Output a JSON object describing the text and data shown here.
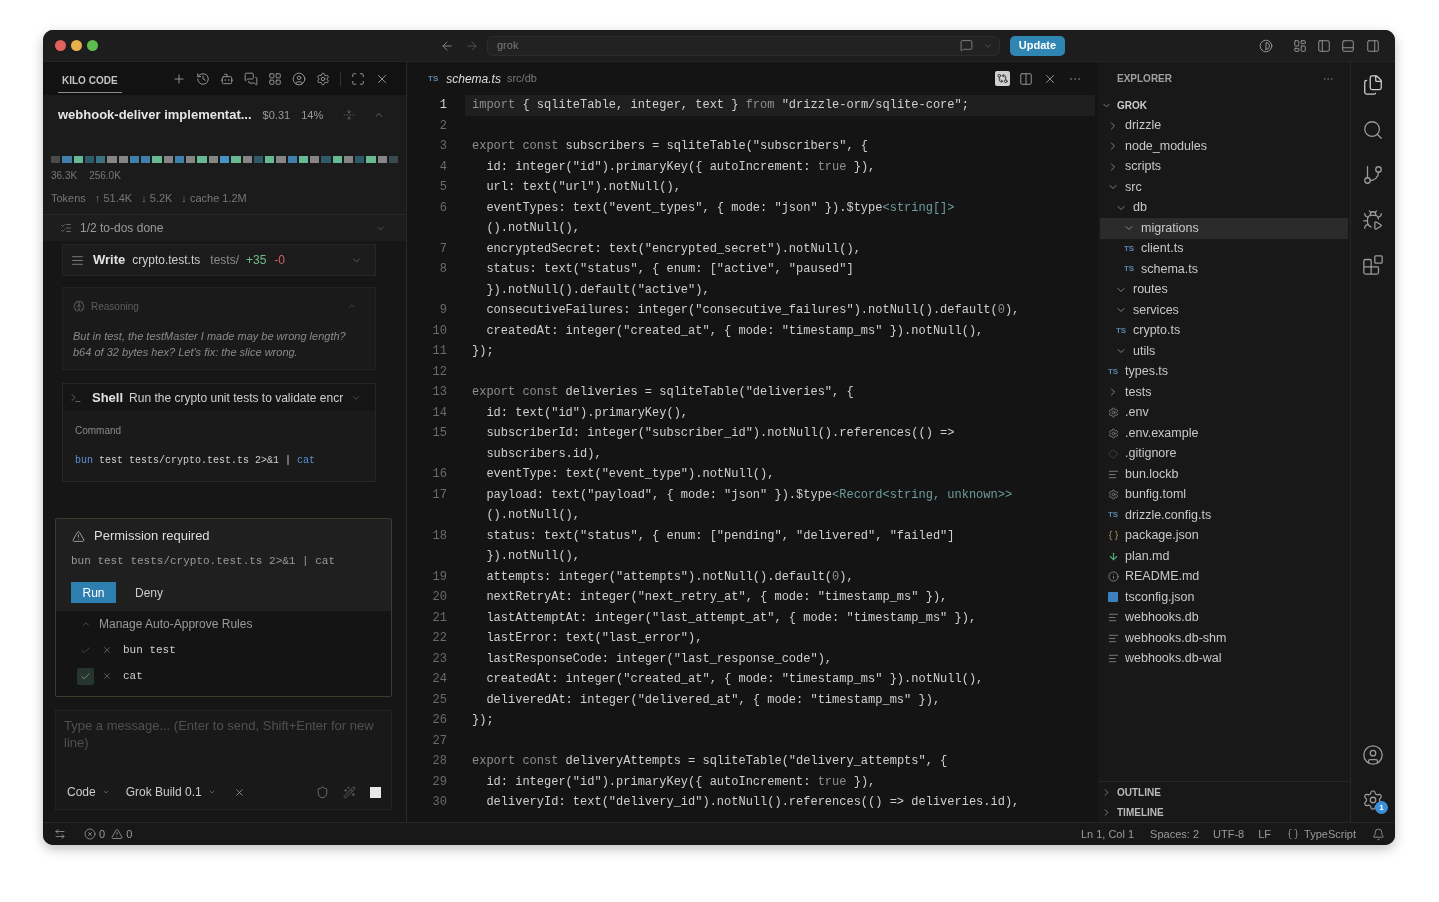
{
  "title_bar": {
    "search": "grok",
    "update": "Update"
  },
  "kilo": {
    "tab": {
      "label": "KILO CODE",
      "selected": true
    },
    "task": {
      "title": "webhook-deliver implementat...",
      "cost": "$0.31",
      "usage": "14%",
      "expanded": true
    },
    "context": {
      "used": "36.3K",
      "limit": "256.0K"
    },
    "tokens": {
      "label": "Tokens",
      "input": "↑ 51.4K",
      "output": "↓ 5.2K",
      "cache": "↓ cache 1.2M"
    },
    "todos": {
      "label": "1/2 to-dos done",
      "expanded": false
    },
    "messages": [
      {
        "kind": "write",
        "title": "Write",
        "file": "crypto.test.ts",
        "folder": "tests/",
        "added": "+35",
        "removed": "-0",
        "expanded": false
      },
      {
        "kind": "reasoning",
        "title": "Reasoning",
        "text": "But in test, the testMaster I made may be wrong length? b64 of 32 bytes hex? Let's fix: the slice wrong.",
        "expanded": true
      },
      {
        "kind": "shell",
        "title": "Shell",
        "description": "Run the crypto unit tests to validate encr",
        "label": "Command",
        "command": [
          {
            "kind": "program",
            "text": "bun"
          },
          {
            "kind": "argument",
            "text": " test tests/crypto.test.ts 2>&1 | "
          },
          {
            "kind": "program",
            "text": "cat"
          }
        ]
      }
    ],
    "permission": {
      "title": "Permission required",
      "command": "bun test tests/crypto.test.ts 2>&1 | cat",
      "run": "Run",
      "deny": "Deny",
      "rules_title": "Manage Auto-Approve Rules",
      "rules_expanded": true,
      "rules": [
        {
          "pattern": "bun test",
          "checked": false
        },
        {
          "pattern": "cat",
          "checked": true
        }
      ]
    },
    "composer": {
      "placeholder": "Type a message... (Enter to send, Shift+Enter for new line)",
      "mode": "Code",
      "model": "Grok Build 0.1"
    }
  },
  "editor": {
    "tab": {
      "icon": "TS",
      "file": "schema.ts",
      "folder": "src/db"
    },
    "lines": [
      {
        "number": "1",
        "current": true,
        "rows": [
          [
            {
              "kind": "keyword",
              "text": "import"
            },
            {
              "kind": "plain",
              "text": " { sqliteTable, integer, text } "
            },
            {
              "kind": "keyword",
              "text": "from"
            },
            {
              "kind": "plain",
              "text": " \"drizzle-orm/sqlite-core\";"
            }
          ]
        ]
      },
      {
        "number": "2",
        "current": false
      },
      {
        "number": "3",
        "current": false,
        "rows": [
          [
            {
              "kind": "keyword",
              "text": "export const"
            },
            {
              "kind": "plain",
              "text": " subscribers = sqliteTable(\"subscribers\", {"
            }
          ]
        ]
      },
      {
        "number": "4",
        "current": false,
        "rows": [
          [
            {
              "kind": "plain",
              "text": "  id: integer(\"id\").primaryKey({ autoIncrement: "
            },
            {
              "kind": "literal",
              "text": "true"
            },
            {
              "kind": "plain",
              "text": " }),"
            }
          ]
        ]
      },
      {
        "number": "5",
        "current": false,
        "rows": [
          [
            {
              "kind": "plain",
              "text": "  url: text(\"url\").notNull(),"
            }
          ]
        ]
      },
      {
        "number": "6",
        "current": false,
        "rows": [
          [
            {
              "kind": "plain",
              "text": "  eventTypes: text(\"event_types\", { mode: \"json\" }).$type"
            },
            {
              "kind": "type",
              "text": "<string[]>"
            }
          ],
          [
            {
              "kind": "plain",
              "text": "  ().notNull(),"
            }
          ]
        ]
      },
      {
        "number": "7",
        "current": false,
        "rows": [
          [
            {
              "kind": "plain",
              "text": "  encryptedSecret: text(\"encrypted_secret\").notNull(),"
            }
          ]
        ]
      },
      {
        "number": "8",
        "current": false,
        "rows": [
          [
            {
              "kind": "plain",
              "text": "  status: text(\"status\", { enum: [\"active\", \"paused\"]"
            }
          ],
          [
            {
              "kind": "plain",
              "text": "  }).notNull().default(\"active\"),"
            }
          ]
        ]
      },
      {
        "number": "9",
        "current": false,
        "rows": [
          [
            {
              "kind": "plain",
              "text": "  consecutiveFailures: integer(\"consecutive_failures\").notNull().default("
            },
            {
              "kind": "literal",
              "text": "0"
            },
            {
              "kind": "plain",
              "text": "),"
            }
          ]
        ]
      },
      {
        "number": "10",
        "current": false,
        "rows": [
          [
            {
              "kind": "plain",
              "text": "  createdAt: integer(\"created_at\", { mode: \"timestamp_ms\" }).notNull(),"
            }
          ]
        ]
      },
      {
        "number": "11",
        "current": false,
        "rows": [
          [
            {
              "kind": "plain",
              "text": "});"
            }
          ]
        ]
      },
      {
        "number": "12",
        "current": false
      },
      {
        "number": "13",
        "current": false,
        "rows": [
          [
            {
              "kind": "keyword",
              "text": "export const"
            },
            {
              "kind": "plain",
              "text": " deliveries = sqliteTable(\"deliveries\", {"
            }
          ]
        ]
      },
      {
        "number": "14",
        "current": false,
        "rows": [
          [
            {
              "kind": "plain",
              "text": "  id: text(\"id\").primaryKey(),"
            }
          ]
        ]
      },
      {
        "number": "15",
        "current": false,
        "rows": [
          [
            {
              "kind": "plain",
              "text": "  subscriberId: integer(\"subscriber_id\").notNull().references(() =>"
            }
          ],
          [
            {
              "kind": "plain",
              "text": "  subscribers.id),"
            }
          ]
        ]
      },
      {
        "number": "16",
        "current": false,
        "rows": [
          [
            {
              "kind": "plain",
              "text": "  eventType: text(\"event_type\").notNull(),"
            }
          ]
        ]
      },
      {
        "number": "17",
        "current": false,
        "rows": [
          [
            {
              "kind": "plain",
              "text": "  payload: text(\"payload\", { mode: \"json\" }).$type"
            },
            {
              "kind": "type",
              "text": "<Record<string, unknown>>"
            }
          ],
          [
            {
              "kind": "plain",
              "text": "  ().notNull(),"
            }
          ]
        ]
      },
      {
        "number": "18",
        "current": false,
        "rows": [
          [
            {
              "kind": "plain",
              "text": "  status: text(\"status\", { enum: [\"pending\", \"delivered\", \"failed\"]"
            }
          ],
          [
            {
              "kind": "plain",
              "text": "  }).notNull(),"
            }
          ]
        ]
      },
      {
        "number": "19",
        "current": false,
        "rows": [
          [
            {
              "kind": "plain",
              "text": "  attempts: integer(\"attempts\").notNull().default("
            },
            {
              "kind": "literal",
              "text": "0"
            },
            {
              "kind": "plain",
              "text": "),"
            }
          ]
        ]
      },
      {
        "number": "20",
        "current": false,
        "rows": [
          [
            {
              "kind": "plain",
              "text": "  nextRetryAt: integer(\"next_retry_at\", { mode: \"timestamp_ms\" }),"
            }
          ]
        ]
      },
      {
        "number": "21",
        "current": false,
        "rows": [
          [
            {
              "kind": "plain",
              "text": "  lastAttemptAt: integer(\"last_attempt_at\", { mode: \"timestamp_ms\" }),"
            }
          ]
        ]
      },
      {
        "number": "22",
        "current": false,
        "rows": [
          [
            {
              "kind": "plain",
              "text": "  lastError: text(\"last_error\"),"
            }
          ]
        ]
      },
      {
        "number": "23",
        "current": false,
        "rows": [
          [
            {
              "kind": "plain",
              "text": "  lastResponseCode: integer(\"last_response_code\"),"
            }
          ]
        ]
      },
      {
        "number": "24",
        "current": false,
        "rows": [
          [
            {
              "kind": "plain",
              "text": "  createdAt: integer(\"created_at\", { mode: \"timestamp_ms\" }).notNull(),"
            }
          ]
        ]
      },
      {
        "number": "25",
        "current": false,
        "rows": [
          [
            {
              "kind": "plain",
              "text": "  deliveredAt: integer(\"delivered_at\", { mode: \"timestamp_ms\" }),"
            }
          ]
        ]
      },
      {
        "number": "26",
        "current": false,
        "rows": [
          [
            {
              "kind": "plain",
              "text": "});"
            }
          ]
        ]
      },
      {
        "number": "27",
        "current": false
      },
      {
        "number": "28",
        "current": false,
        "rows": [
          [
            {
              "kind": "keyword",
              "text": "export const"
            },
            {
              "kind": "plain",
              "text": " deliveryAttempts = sqliteTable(\"delivery_attempts\", {"
            }
          ]
        ]
      },
      {
        "number": "29",
        "current": false,
        "rows": [
          [
            {
              "kind": "plain",
              "text": "  id: integer(\"id\").primaryKey({ autoIncrement: "
            },
            {
              "kind": "literal",
              "text": "true"
            },
            {
              "kind": "plain",
              "text": " }),"
            }
          ]
        ]
      },
      {
        "number": "30",
        "current": false,
        "rows": [
          [
            {
              "kind": "plain",
              "text": "  deliveryId: text(\"delivery_id\").notNull().references(() => deliveries.id),"
            }
          ]
        ]
      }
    ]
  },
  "explorer": {
    "title": "EXPLORER",
    "root": {
      "label": "GROK",
      "expanded": true,
      "children": [
        {
          "label": "drizzle",
          "kind": "folder",
          "expanded": false,
          "selected": false
        },
        {
          "label": "node_modules",
          "kind": "folder",
          "expanded": false,
          "selected": false
        },
        {
          "label": "scripts",
          "kind": "folder",
          "expanded": false,
          "selected": false
        },
        {
          "label": "src",
          "kind": "folder",
          "expanded": true,
          "selected": false,
          "children": [
            {
              "label": "db",
              "kind": "folder",
              "expanded": true,
              "selected": false,
              "children": [
                {
                  "label": "migrations",
                  "kind": "folder",
                  "expanded": true,
                  "selected": true
                },
                {
                  "label": "client.ts",
                  "kind": "typescript",
                  "icon": "TS",
                  "selected": false
                },
                {
                  "label": "schema.ts",
                  "kind": "typescript",
                  "icon": "TS",
                  "selected": false
                }
              ]
            },
            {
              "label": "routes",
              "kind": "folder",
              "expanded": true,
              "selected": false
            },
            {
              "label": "services",
              "kind": "folder",
              "expanded": true,
              "selected": false
            },
            {
              "label": "crypto.ts",
              "kind": "typescript",
              "icon": "TS",
              "selected": false
            },
            {
              "label": "utils",
              "kind": "folder",
              "expanded": true,
              "selected": false
            }
          ]
        },
        {
          "label": "types.ts",
          "kind": "typescript",
          "icon": "TS",
          "selected": false
        },
        {
          "label": "tests",
          "kind": "folder",
          "expanded": false,
          "selected": false
        },
        {
          "label": ".env",
          "kind": "settings",
          "selected": false
        },
        {
          "label": ".env.example",
          "kind": "settings",
          "selected": false
        },
        {
          "label": ".gitignore",
          "kind": "git",
          "selected": false
        },
        {
          "label": "bun.lockb",
          "kind": "lines",
          "selected": false
        },
        {
          "label": "bunfig.toml",
          "kind": "settings",
          "selected": false
        },
        {
          "label": "drizzle.config.ts",
          "kind": "typescript",
          "icon": "TS",
          "selected": false
        },
        {
          "label": "package.json",
          "kind": "json",
          "selected": false
        },
        {
          "label": "plan.md",
          "kind": "markdown",
          "selected": false
        },
        {
          "label": "README.md",
          "kind": "info",
          "selected": false
        },
        {
          "label": "tsconfig.json",
          "kind": "tsconfig",
          "selected": false
        },
        {
          "label": "webhooks.db",
          "kind": "lines",
          "selected": false
        },
        {
          "label": "webhooks.db-shm",
          "kind": "lines",
          "selected": false
        },
        {
          "label": "webhooks.db-wal",
          "kind": "lines",
          "selected": false
        }
      ]
    },
    "sections": [
      {
        "label": "OUTLINE",
        "expanded": false
      },
      {
        "label": "TIMELINE",
        "expanded": false
      }
    ]
  },
  "activity_bar": {
    "settings_badge": "1"
  },
  "status_bar": {
    "errors": "0",
    "warnings": "0",
    "cursor": "Ln 1, Col 1",
    "indentation": "Spaces: 2",
    "encoding": "UTF-8",
    "line_ending": "LF",
    "language": "TypeScript"
  }
}
